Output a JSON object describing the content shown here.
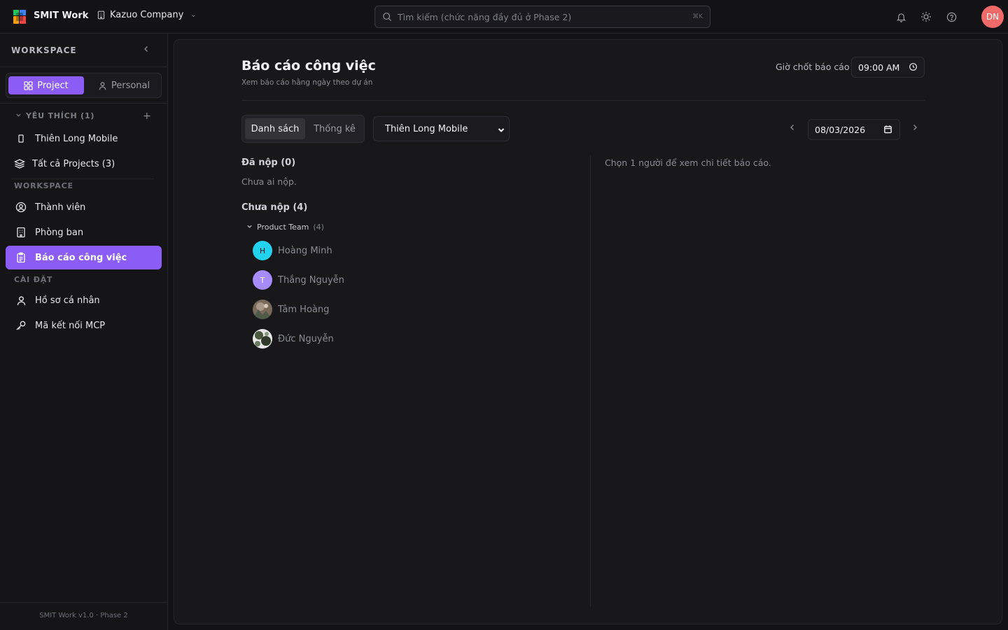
{
  "app": {
    "name": "SMIT Work",
    "company": "Kazuo Company",
    "user_initials": "DN"
  },
  "search": {
    "placeholder": "Tìm kiếm (chức năng đầy đủ ở Phase 2)",
    "shortcut": "⌘K"
  },
  "sidebar": {
    "header": "WORKSPACE",
    "segment": {
      "project": "Project",
      "personal": "Personal"
    },
    "favorites_header": "YÊU THÍCH (1)",
    "favorites": [
      {
        "label": "Thiên Long Mobile",
        "icon": "project-icon"
      },
      {
        "label": "Tất cả Projects (3)",
        "icon": "layers-icon"
      }
    ],
    "workspace_label": "WORKSPACE",
    "workspace_items": [
      {
        "label": "Thành viên",
        "icon": "user-circle-icon"
      },
      {
        "label": "Phòng ban",
        "icon": "building-icon"
      },
      {
        "label": "Báo cáo công việc",
        "icon": "clipboard-icon",
        "active": true
      }
    ],
    "settings_label": "CÀI ĐẶT",
    "settings_items": [
      {
        "label": "Hồ sơ cá nhân",
        "icon": "user-icon"
      },
      {
        "label": "Mã kết nối MCP",
        "icon": "key-icon"
      }
    ],
    "footer": "SMIT Work v1.0 · Phase 2"
  },
  "main": {
    "title": "Báo cáo công việc",
    "subtitle": "Xem báo cáo hằng ngày theo dự án",
    "deadline_label": "Giờ chốt báo cáo",
    "deadline_value": "09:00 AM",
    "tabs": {
      "list": "Danh sách",
      "stats": "Thống kê"
    },
    "project_select": "Thiên Long Mobile",
    "date": "08/03/2026",
    "submitted_header": "Đã nộp (0)",
    "submitted_empty": "Chưa ai nộp.",
    "pending_header": "Chưa nộp (4)",
    "group": {
      "name": "Product Team",
      "count": "(4)"
    },
    "people": [
      {
        "name": "Hoàng Minh",
        "initial": "H",
        "color": "#22d3ee"
      },
      {
        "name": "Thắng Nguyễn",
        "initial": "T",
        "color": "#a78bfa"
      },
      {
        "name": "Tâm Hoàng",
        "initial": "",
        "color": "#7a6a5a"
      },
      {
        "name": "Đức Nguyễn",
        "initial": "",
        "color": "#6b7b5e"
      }
    ],
    "detail_hint": "Chọn 1 người để xem chi tiết báo cáo."
  },
  "colors": {
    "accent": "#8b5cf6",
    "avatar_dn": "#f06a6a",
    "background": "#131316"
  }
}
